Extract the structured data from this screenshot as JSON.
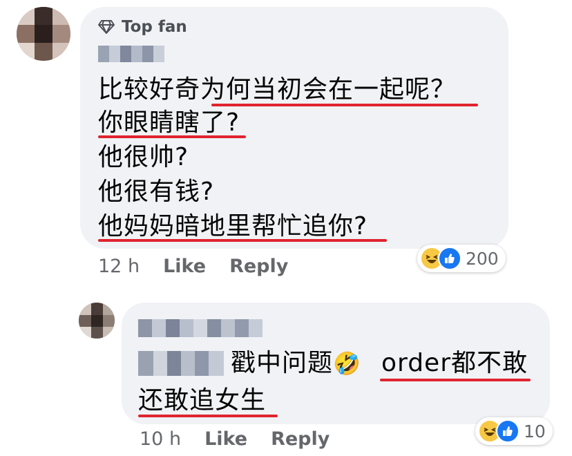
{
  "comment1": {
    "badge": "Top fan",
    "lines": [
      "比较好奇为何当初会在一起呢？",
      "你眼睛瞎了?",
      "他很帅?",
      "他很有钱?",
      "他妈妈暗地里帮忙追你?"
    ],
    "time": "12 h",
    "like_label": "Like",
    "reply_label": "Reply",
    "reaction_count": "200",
    "reactions": [
      "haha-icon",
      "like-icon"
    ]
  },
  "comment2": {
    "text_line1": "戳中问题",
    "emoji": "🤣",
    "text_line1b": "order都不敢",
    "text_line2": "还敢追女生",
    "time": "10 h",
    "like_label": "Like",
    "reply_label": "Reply",
    "reaction_count": "10",
    "reactions": [
      "haha-icon",
      "like-icon"
    ]
  },
  "colors": {
    "bubble": "#f0f2f5",
    "underline": "#e0242f",
    "meta_text": "#65676b",
    "like_blue": "#1877f2",
    "haha_yellow": "#f7c844"
  }
}
